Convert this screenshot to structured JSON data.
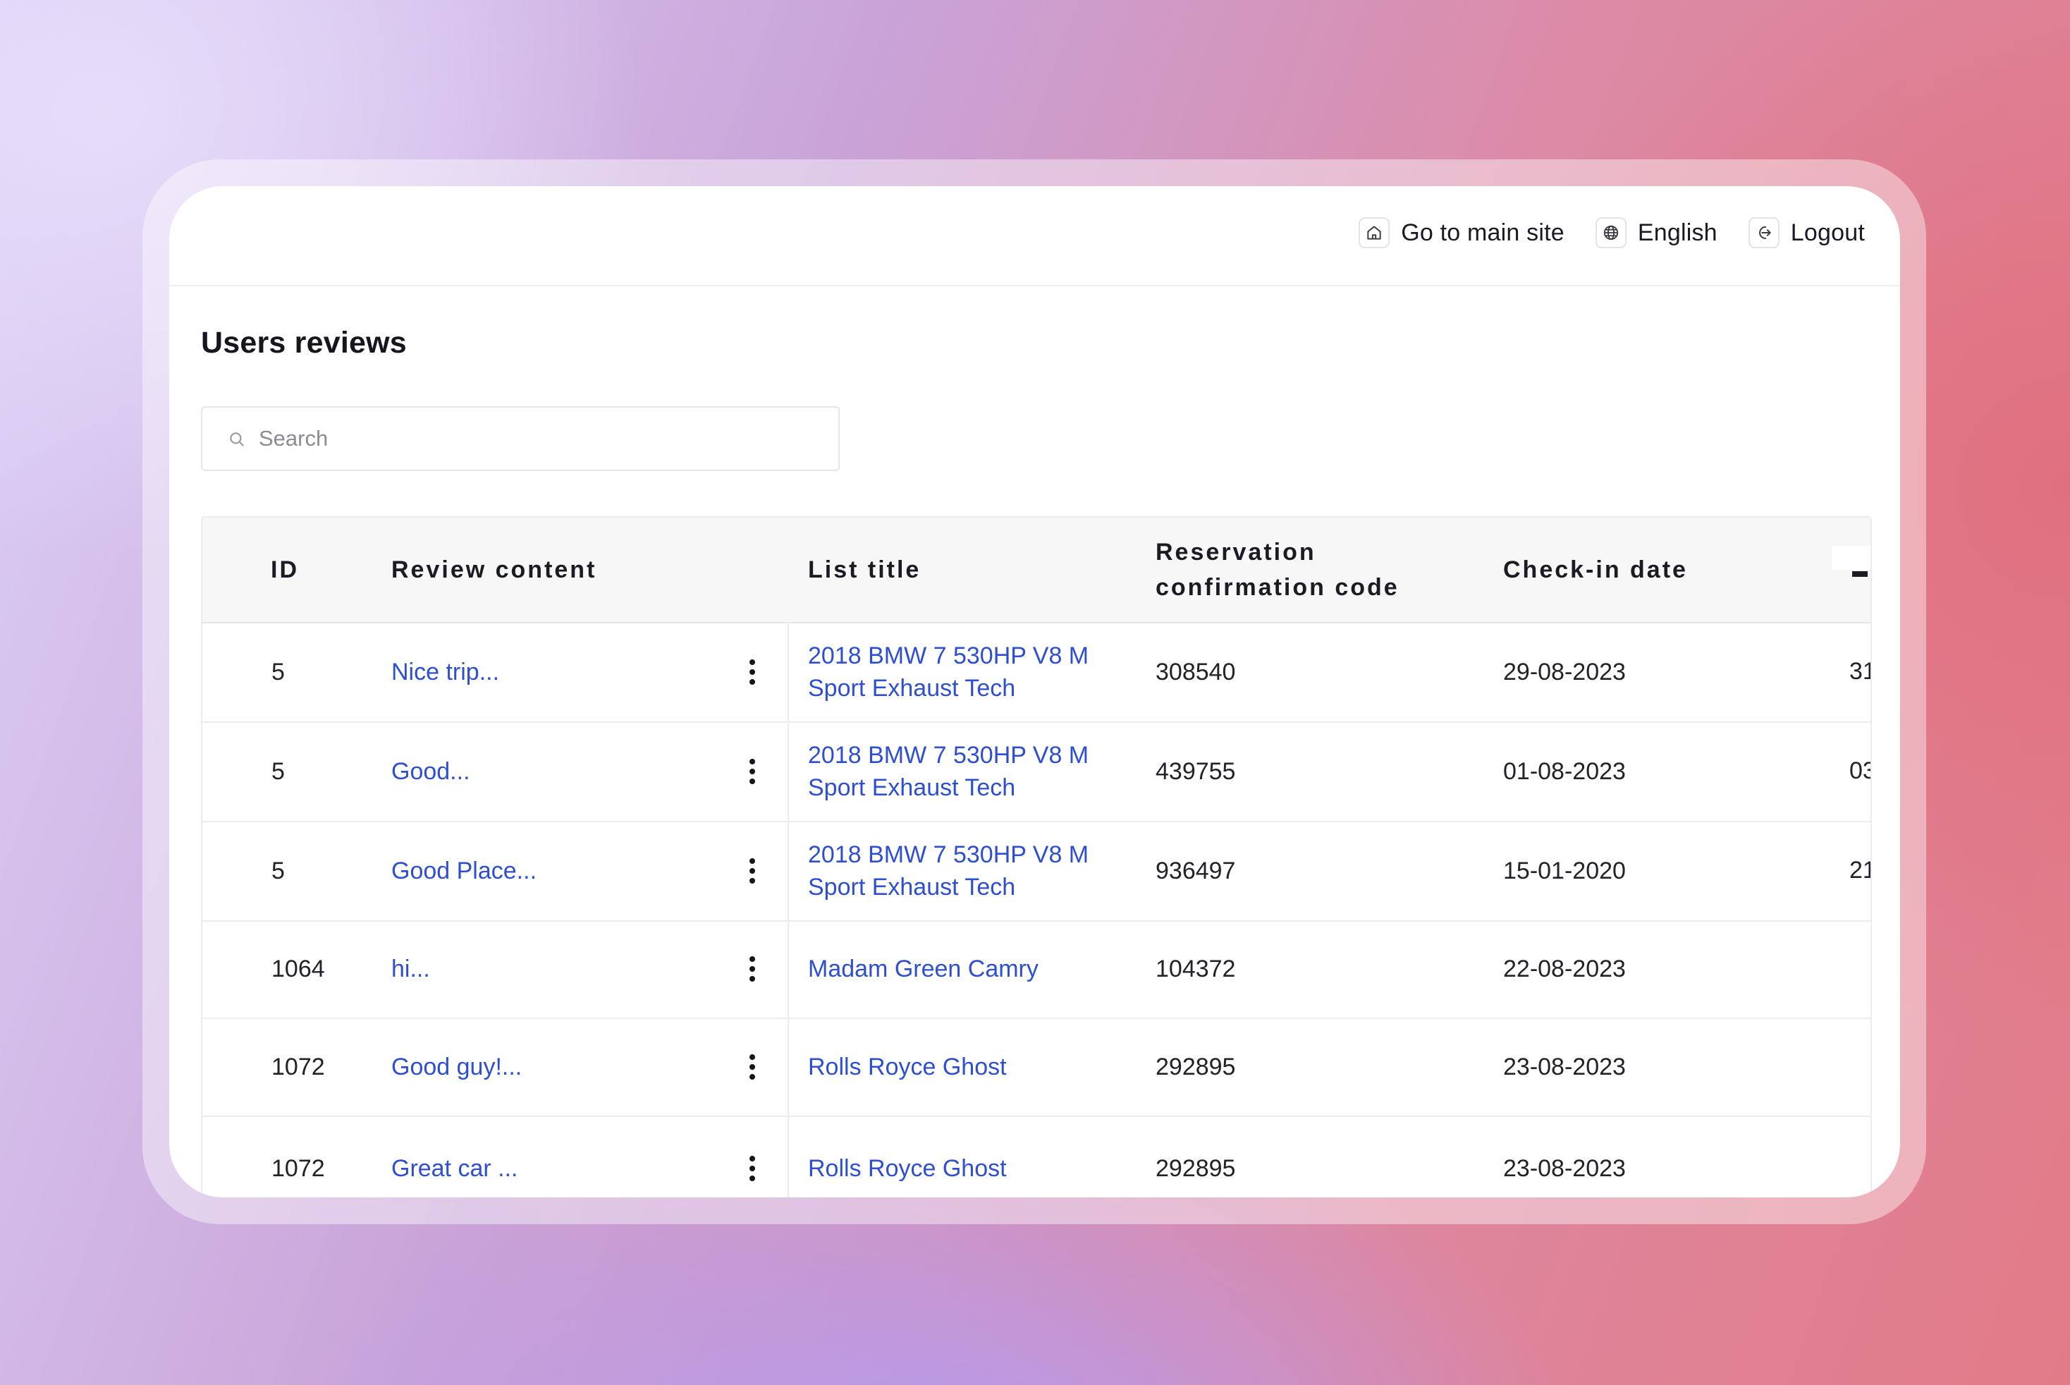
{
  "header": {
    "main_site_label": "Go to main site",
    "language_label": "English",
    "logout_label": "Logout"
  },
  "page": {
    "title": "Users reviews"
  },
  "search": {
    "placeholder": "Search"
  },
  "table": {
    "columns": {
      "id": "ID",
      "review_content": "Review content",
      "list_title": "List title",
      "reservation_code_line1": "Reservation",
      "reservation_code_line2": "confirmation code",
      "check_in_date": "Check-in date"
    },
    "rows": [
      {
        "id": "5",
        "review": "Nice trip...",
        "title_line1": "2018 BMW 7 530HP V8 M",
        "title_line2": "Sport Exhaust Tech",
        "code": "308540",
        "check_in": "29-08-2023",
        "next_col": "31"
      },
      {
        "id": "5",
        "review": "Good...",
        "title_line1": "2018 BMW 7 530HP V8 M",
        "title_line2": "Sport Exhaust Tech",
        "code": "439755",
        "check_in": "01-08-2023",
        "next_col": "03"
      },
      {
        "id": "5",
        "review": "Good Place...",
        "title_line1": "2018 BMW 7 530HP V8 M",
        "title_line2": "Sport Exhaust Tech",
        "code": "936497",
        "check_in": "15-01-2020",
        "next_col": "21"
      },
      {
        "id": "1064",
        "review": "hi...",
        "title_line1": "Madam Green Camry",
        "title_line2": "",
        "code": "104372",
        "check_in": "22-08-2023",
        "next_col": ""
      },
      {
        "id": "1072",
        "review": "Good guy!...",
        "title_line1": "Rolls Royce Ghost",
        "title_line2": "",
        "code": "292895",
        "check_in": "23-08-2023",
        "next_col": ""
      },
      {
        "id": "1072",
        "review": "Great car ...",
        "title_line1": "Rolls Royce Ghost",
        "title_line2": "",
        "code": "292895",
        "check_in": "23-08-2023",
        "next_col": ""
      }
    ]
  },
  "colors": {
    "link": "#2e4fcf",
    "text": "#22222b",
    "header_bg": "#f7f7f8",
    "border": "#ececf0"
  },
  "icons": {
    "main_site": "home-icon",
    "language": "globe-icon",
    "logout": "logout-icon",
    "search": "search-icon",
    "row_menu": "kebab-menu-icon"
  }
}
